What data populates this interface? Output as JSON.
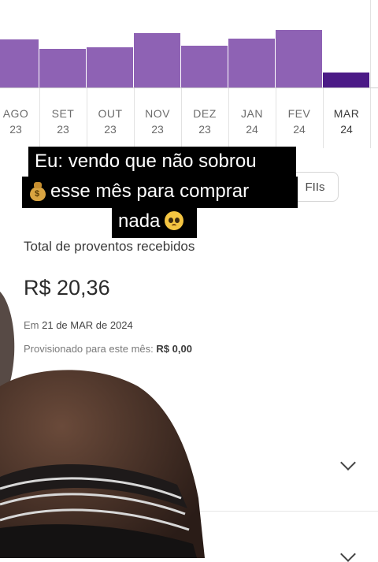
{
  "chart_data": {
    "type": "bar",
    "categories": [
      "AGO 23",
      "SET 23",
      "OUT 23",
      "NOV 23",
      "DEZ 23",
      "JAN 24",
      "FEV 24",
      "MAR 24"
    ],
    "months": [
      "AGO",
      "SET",
      "OUT",
      "NOV",
      "DEZ",
      "JAN",
      "FEV",
      "MAR"
    ],
    "years": [
      "23",
      "23",
      "23",
      "23",
      "23",
      "24",
      "24",
      "24"
    ],
    "values": [
      62,
      50,
      52,
      70,
      54,
      63,
      74,
      20
    ],
    "colors": [
      "#8e62b4",
      "#8e62b4",
      "#8e62b4",
      "#8e62b4",
      "#8e62b4",
      "#8e62b4",
      "#8e62b4",
      "#4b1a86"
    ],
    "active_index": 7,
    "ylim": [
      0,
      112
    ]
  },
  "tabs": {
    "fiis_label": "FIIs"
  },
  "caption": {
    "line1": "Eu: vendo que não sobrou",
    "line2": "esse mês para comprar",
    "line3": "nada",
    "emoji1": "money-bag-icon",
    "emoji2": "pleading-face-icon"
  },
  "summary": {
    "total_label": "Total de proventos recebidos",
    "total_value": "R$ 20,36",
    "date_prefix": "Em",
    "date_value": "21 de MAR de 2024",
    "provisioned_label": "Provisionado para este mês:",
    "provisioned_value": "R$ 0,00"
  },
  "icons": {
    "expand1": "chevron-down-icon",
    "expand2": "chevron-down-icon"
  },
  "colors": {
    "bar": "#8e62b4",
    "bar_active": "#4b1a86"
  }
}
